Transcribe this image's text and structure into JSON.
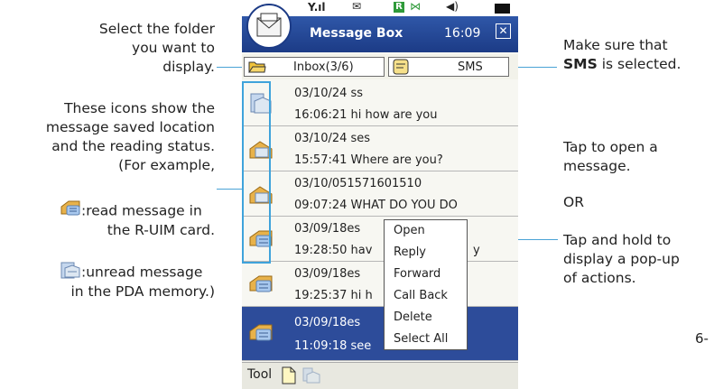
{
  "annotations": {
    "folder": [
      "Select the folder",
      "you want to",
      "display."
    ],
    "sms_prefix": "Make sure that",
    "sms_bold": "SMS",
    "sms_suffix": "is selected.",
    "icons": [
      "These icons show the",
      "message saved location",
      "and the reading status.",
      "(For example,"
    ],
    "example_read_1": ":read message in",
    "example_read_2": "the R-UIM card.",
    "example_unread_1": ":unread message",
    "example_unread_2": "in the PDA memory.)",
    "tap_open": [
      "Tap to open a",
      "message."
    ],
    "or": "OR",
    "tap_hold": [
      "Tap and hold to",
      "display a pop-up",
      "of actions."
    ],
    "page_number": "6-"
  },
  "phone": {
    "title": "Message Box",
    "clock": "16:09",
    "close_glyph": "✕",
    "folder_dropdown": "Inbox(3/6)",
    "type_dropdown": "SMS",
    "messages": [
      {
        "line1": "03/10/24 ss",
        "line2": "16:06:21 hi how are you",
        "icon": "unread-pda-icon"
      },
      {
        "line1": "03/10/24 ses",
        "line2": "15:57:41 Where are you?",
        "icon": "read-pda-icon"
      },
      {
        "line1": "03/10/051571601510",
        "line2": "09:07:24 WHAT DO YOU DO",
        "icon": "read-pda-icon"
      },
      {
        "line1": "03/09/18es",
        "line2": "19:28:50 hav",
        "line2_tail": "y",
        "icon": "read-ruim-icon"
      },
      {
        "line1": "03/09/18es",
        "line2": "19:25:37 hi h",
        "icon": "read-ruim-icon"
      },
      {
        "line1": "03/09/18es",
        "line2": "11:09:18 see",
        "icon": "read-ruim-icon"
      }
    ],
    "popup_menu": [
      "Open",
      "Reply",
      "Forward",
      "Call Back",
      "Delete",
      "Select All"
    ],
    "bottom_tool": "Tool",
    "colors": {
      "title_bar": "#1c3b86",
      "selected_row": "#2d4c9a",
      "callout_line": "#4aa3d6"
    }
  }
}
